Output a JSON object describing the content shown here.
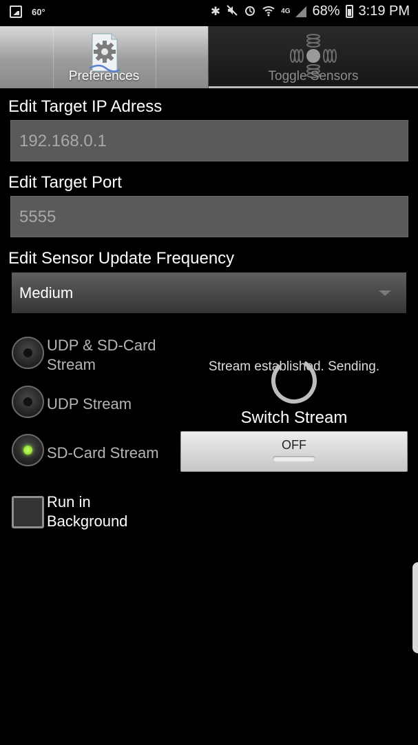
{
  "status_bar": {
    "temperature": "60°",
    "network": "4G",
    "battery": "68%",
    "time": "3:19 PM",
    "icons": [
      "image-icon",
      "bluetooth-icon",
      "mute-icon",
      "alarm-icon",
      "wifi-icon",
      "signal-icon",
      "battery-icon"
    ]
  },
  "tabs": [
    {
      "label": "Preferences",
      "icon": "gear-document-icon",
      "selected": true
    },
    {
      "label": "Toggle Sensors",
      "icon": "joystick-icon",
      "selected": false
    }
  ],
  "form": {
    "ip_label": "Edit Target IP Adress",
    "ip_value": "192.168.0.1",
    "port_label": "Edit Target Port",
    "port_value": "5555",
    "freq_label": "Edit Sensor Update Frequency",
    "freq_value": "Medium"
  },
  "stream_options": [
    {
      "label": "UDP & SD-Card\nStream",
      "selected": false
    },
    {
      "label": "UDP Stream",
      "selected": false
    },
    {
      "label": "SD-Card Stream",
      "selected": true
    }
  ],
  "run_in_background": {
    "label": "Run in\nBackground",
    "checked": false
  },
  "stream": {
    "status": "Stream established. Sending.",
    "switch_label": "Switch Stream",
    "toggle_value": "OFF"
  },
  "colors": {
    "radio_selected": "#8fe02a",
    "tab_selected_bg": "#a0a0a0",
    "field_bg": "#5a5a5a"
  }
}
